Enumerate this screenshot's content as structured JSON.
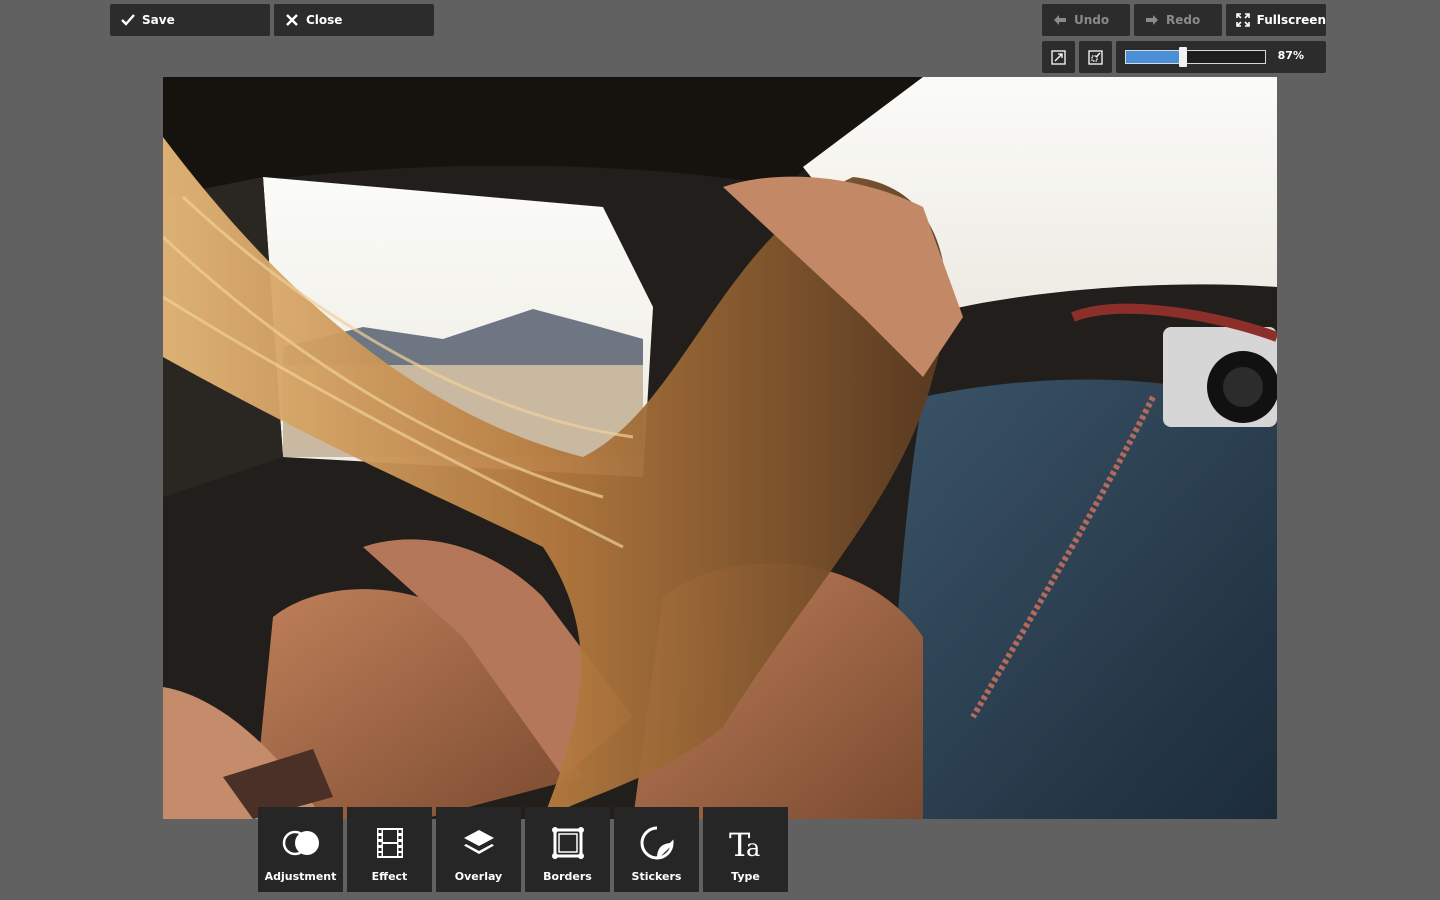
{
  "header": {
    "save_label": "Save",
    "close_label": "Close",
    "undo_label": "Undo",
    "redo_label": "Redo",
    "fullscreen_label": "Fullscreen"
  },
  "zoom": {
    "value_label": "87%",
    "level": 0.87
  },
  "toolbar": {
    "items": [
      {
        "label": "Adjustment",
        "icon": "adjustment-icon"
      },
      {
        "label": "Effect",
        "icon": "film-icon"
      },
      {
        "label": "Overlay",
        "icon": "layers-icon"
      },
      {
        "label": "Borders",
        "icon": "frame-icon"
      },
      {
        "label": "Stickers",
        "icon": "sticker-icon"
      },
      {
        "label": "Type",
        "icon": "type-icon"
      }
    ]
  },
  "colors": {
    "background": "#616161",
    "panel": "#2c2c2c",
    "accent": "#4a90d9"
  }
}
